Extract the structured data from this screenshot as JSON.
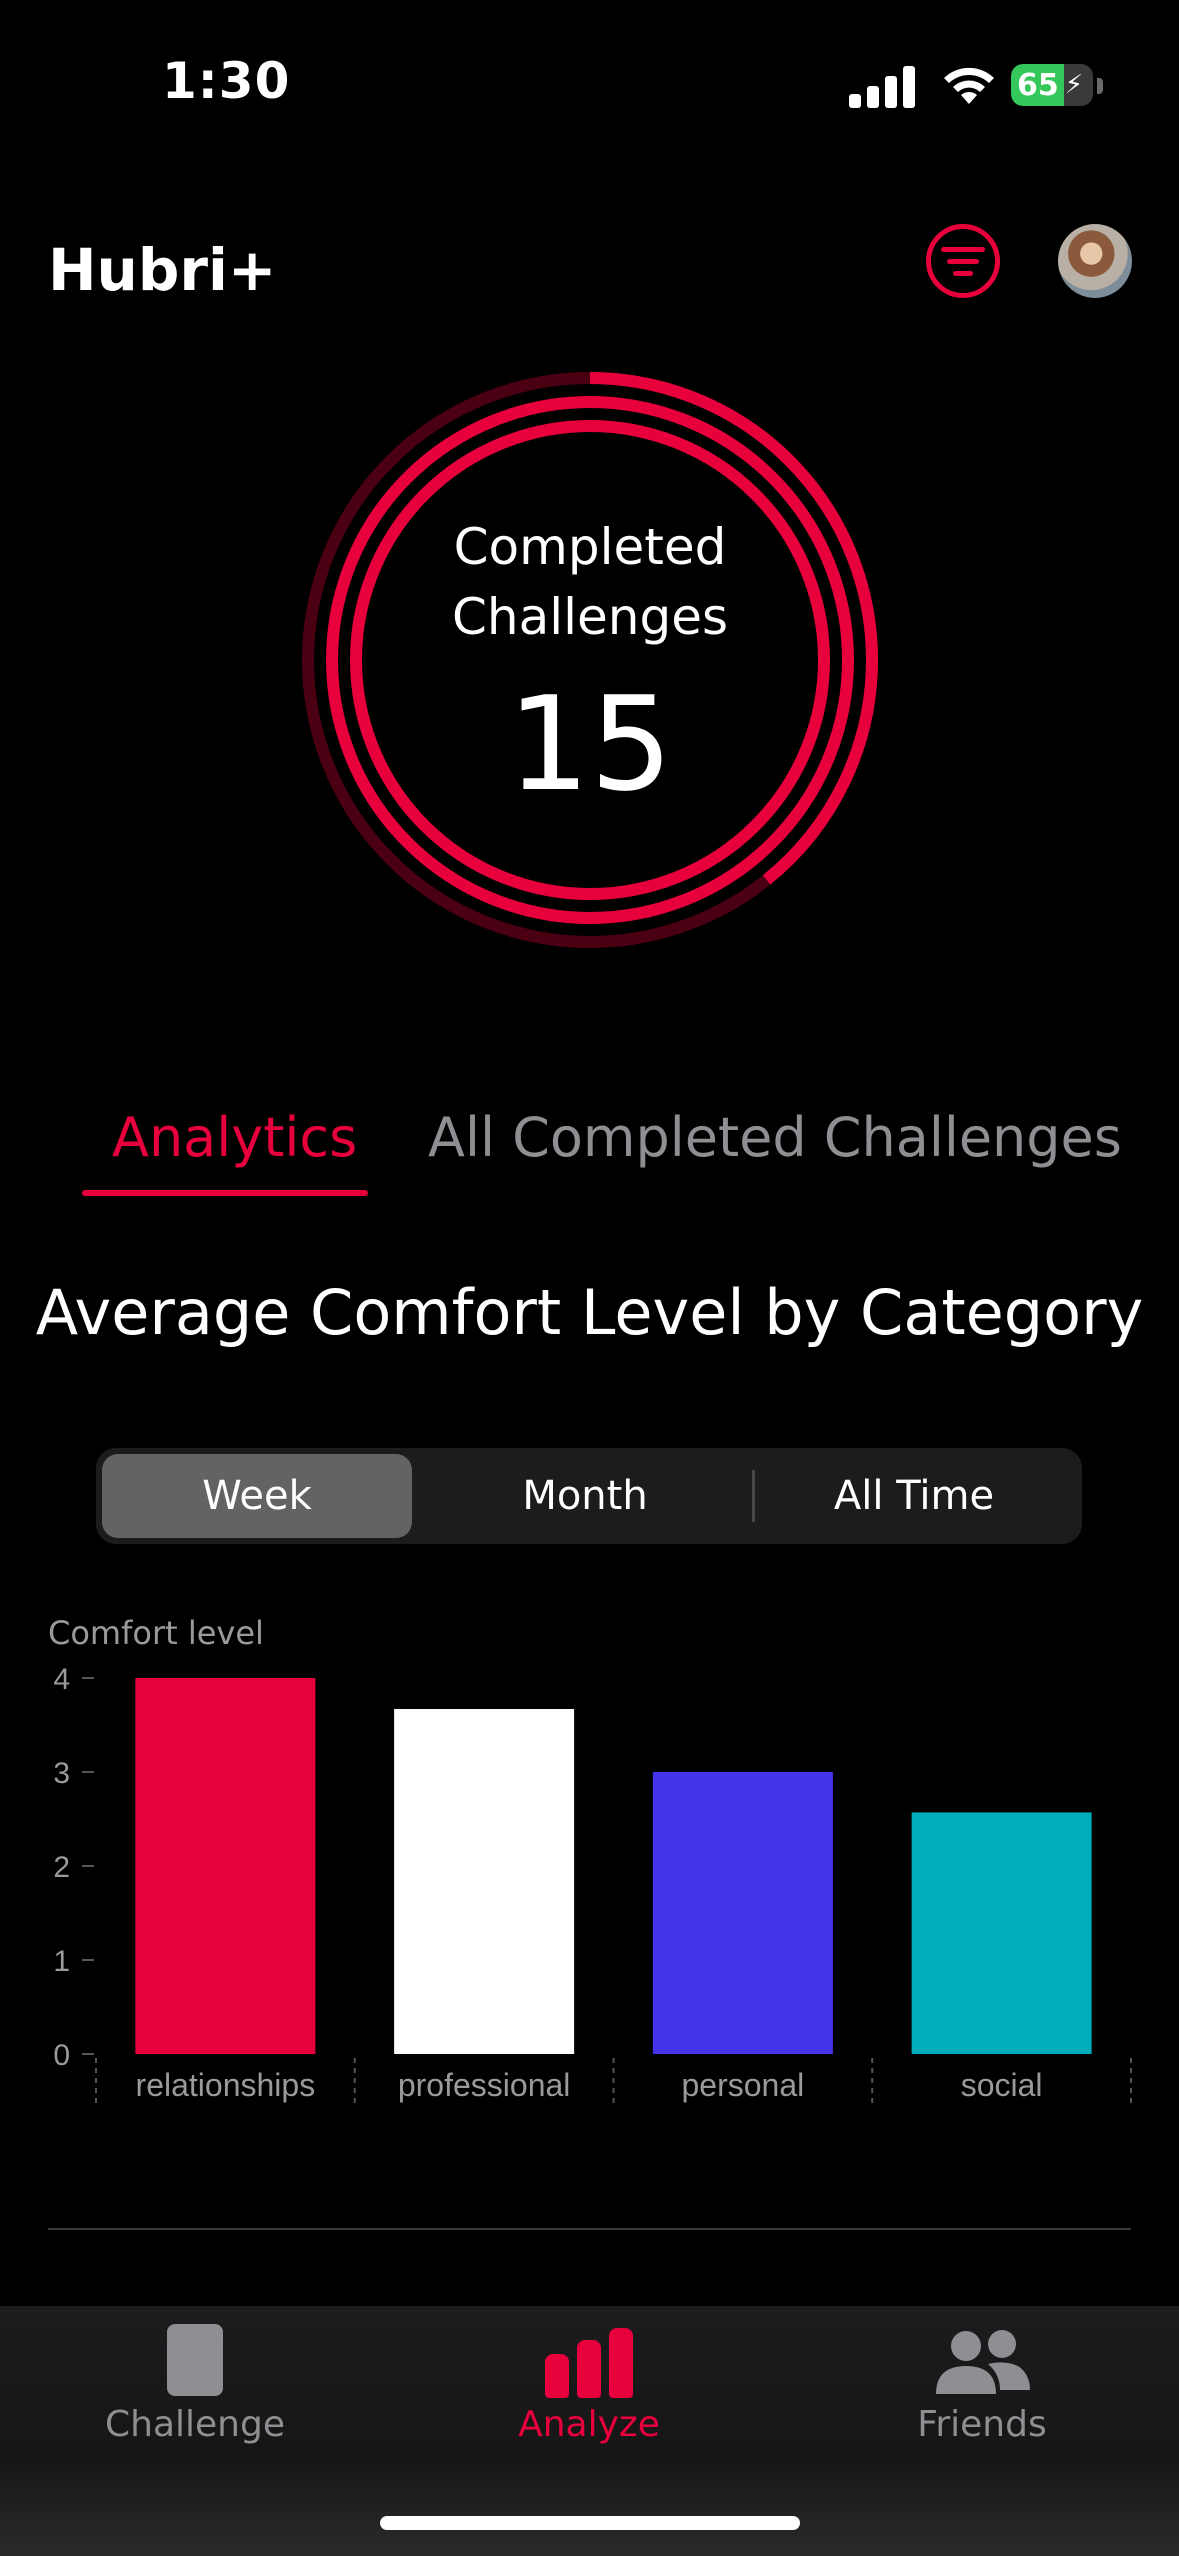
{
  "status_bar": {
    "time": "1:30",
    "battery": "65"
  },
  "header": {
    "title": "Hubri+",
    "filter_icon": "filter-icon",
    "avatar_icon": "avatar"
  },
  "summary": {
    "label_line1": "Completed",
    "label_line2": "Challenges",
    "count": "15"
  },
  "tabs": [
    {
      "label": "Analytics",
      "active": true
    },
    {
      "label": "All Completed Challenges",
      "active": false
    }
  ],
  "section_title": "Average Comfort Level by Category",
  "segmented": [
    {
      "label": "Week",
      "selected": true
    },
    {
      "label": "Month",
      "selected": false
    },
    {
      "label": "All Time",
      "selected": false
    }
  ],
  "chart_data": {
    "type": "bar",
    "ylabel": "Comfort level",
    "xlabel": "",
    "categories": [
      "relationships",
      "professional",
      "personal",
      "social"
    ],
    "values": [
      4.0,
      3.67,
      3.0,
      2.57
    ],
    "colors": [
      "#e8003c",
      "#ffffff",
      "#4535ea",
      "#00adbb"
    ],
    "ylim": [
      0,
      4
    ],
    "yticks": [
      "0",
      "1",
      "2",
      "3",
      "4"
    ]
  },
  "tabbar": [
    {
      "label": "Challenge",
      "icon": "card-icon",
      "active": false
    },
    {
      "label": "Analyze",
      "icon": "bar-chart-icon",
      "active": true
    },
    {
      "label": "Friends",
      "icon": "people-icon",
      "active": false
    }
  ],
  "colors": {
    "accent": "#e8003c",
    "inactive": "#8e8e93",
    "background": "#000000"
  }
}
